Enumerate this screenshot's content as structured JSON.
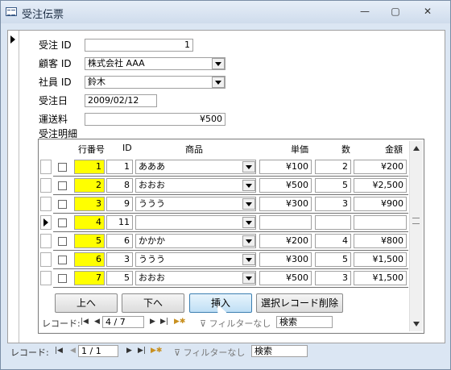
{
  "window": {
    "title": "受注伝票",
    "min": "—",
    "max": "▢",
    "close": "✕"
  },
  "form": {
    "order_id_label": "受注 ID",
    "order_id": "1",
    "customer_label": "顧客 ID",
    "customer": "株式会社 AAA",
    "employee_label": "社員 ID",
    "employee": "鈴木",
    "order_date_label": "受注日",
    "order_date": "2009/02/12",
    "shipping_label": "運送料",
    "shipping": "¥500",
    "details_label": "受注明細"
  },
  "subform": {
    "headers": {
      "row_no": "行番号",
      "id": "ID",
      "product": "商品",
      "price": "単価",
      "qty": "数",
      "amount": "金額"
    },
    "rows": [
      {
        "row_no": "1",
        "id": "1",
        "product": "あああ",
        "price": "¥100",
        "qty": "2",
        "amount": "¥200"
      },
      {
        "row_no": "2",
        "id": "8",
        "product": "おおお",
        "price": "¥500",
        "qty": "5",
        "amount": "¥2,500"
      },
      {
        "row_no": "3",
        "id": "9",
        "product": "ううう",
        "price": "¥300",
        "qty": "3",
        "amount": "¥900"
      },
      {
        "row_no": "4",
        "id": "11",
        "product": "",
        "price": "",
        "qty": "",
        "amount": ""
      },
      {
        "row_no": "5",
        "id": "6",
        "product": "かかか",
        "price": "¥200",
        "qty": "4",
        "amount": "¥800"
      },
      {
        "row_no": "6",
        "id": "3",
        "product": "ううう",
        "price": "¥300",
        "qty": "5",
        "amount": "¥1,500"
      },
      {
        "row_no": "7",
        "id": "5",
        "product": "おおお",
        "price": "¥500",
        "qty": "3",
        "amount": "¥1,500"
      }
    ],
    "buttons": {
      "up": "上へ",
      "down": "下へ",
      "insert": "挿入",
      "delete": "選択レコード削除"
    },
    "nav": {
      "label": "レコード:",
      "record": "4 / 7",
      "filter": "フィルターなし",
      "search": "検索"
    }
  },
  "main_nav": {
    "label": "レコード:",
    "record": "1 / 1",
    "filter": "フィルターなし",
    "search": "検索"
  }
}
